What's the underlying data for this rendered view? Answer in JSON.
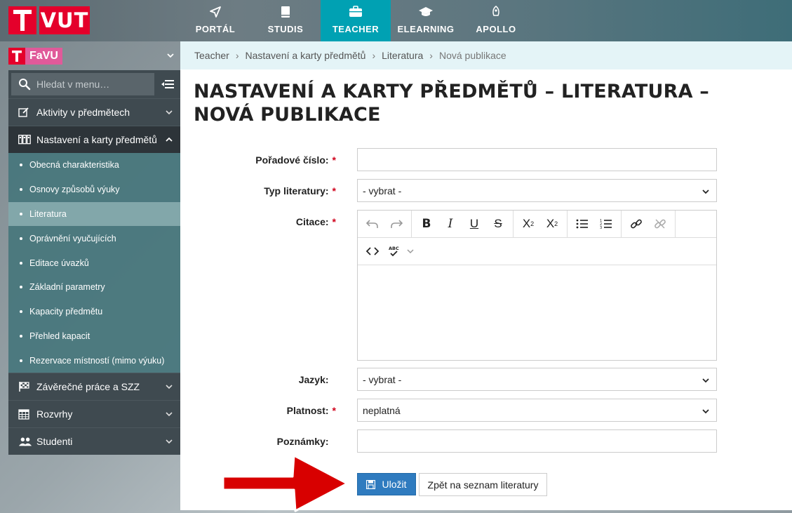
{
  "header": {
    "logo_text": "VUT",
    "tabs": [
      {
        "label": "PORTÁL",
        "icon": "navigation-arrow-icon"
      },
      {
        "label": "STUDIS",
        "icon": "book-icon"
      },
      {
        "label": "TEACHER",
        "icon": "briefcase-icon",
        "active": true
      },
      {
        "label": "ELEARNING",
        "icon": "graduation-cap-icon"
      },
      {
        "label": "APOLLO",
        "icon": "rocket-icon"
      }
    ],
    "active_tab_color": "#00a1b3"
  },
  "faculty": {
    "label": "FaVU",
    "brand_color": "#e4002b",
    "badge_color": "#e05a9a"
  },
  "sidebar": {
    "search_placeholder": "Hledat v menu…",
    "items": [
      {
        "label": "Aktivity v předmětech",
        "icon": "edit-icon"
      },
      {
        "label": "Nastavení a karty předmětů",
        "icon": "cards-icon",
        "open": true
      },
      {
        "label": "Závěrečné práce a SZZ",
        "icon": "checkered-flag-icon"
      },
      {
        "label": "Rozvrhy",
        "icon": "calendar-icon"
      },
      {
        "label": "Studenti",
        "icon": "users-icon"
      }
    ],
    "subitems": [
      "Obecná charakteristika",
      "Osnovy způsobů výuky",
      "Literatura",
      "Oprávnění vyučujících",
      "Editace úvazků",
      "Základní parametry",
      "Kapacity předmětu",
      "Přehled kapacit",
      "Rezervace místností (mimo výuku)"
    ],
    "active_subitem": "Literatura"
  },
  "breadcrumb": [
    "Teacher",
    "Nastavení a karty předmětů",
    "Literatura",
    "Nová publikace"
  ],
  "page": {
    "title": "NASTAVENÍ A KARTY PŘEDMĚTŮ – LITERATURA – NOVÁ PUBLIKACE"
  },
  "form": {
    "poradove_cislo": {
      "label": "Pořadové číslo:",
      "required": "*",
      "value": ""
    },
    "typ_literatury": {
      "label": "Typ literatury:",
      "required": "*",
      "value": "- vybrat -"
    },
    "citace": {
      "label": "Citace:",
      "required": "*",
      "value": ""
    },
    "jazyk": {
      "label": "Jazyk:",
      "value": "- vybrat -"
    },
    "platnost": {
      "label": "Platnost:",
      "required": "*",
      "value": "neplatná"
    },
    "poznamky": {
      "label": "Poznámky:",
      "value": ""
    },
    "save_label": "Uložit",
    "back_label": "Zpět na seznam literatury"
  },
  "editor_toolbar": {
    "spellcheck_label": "ABC"
  }
}
